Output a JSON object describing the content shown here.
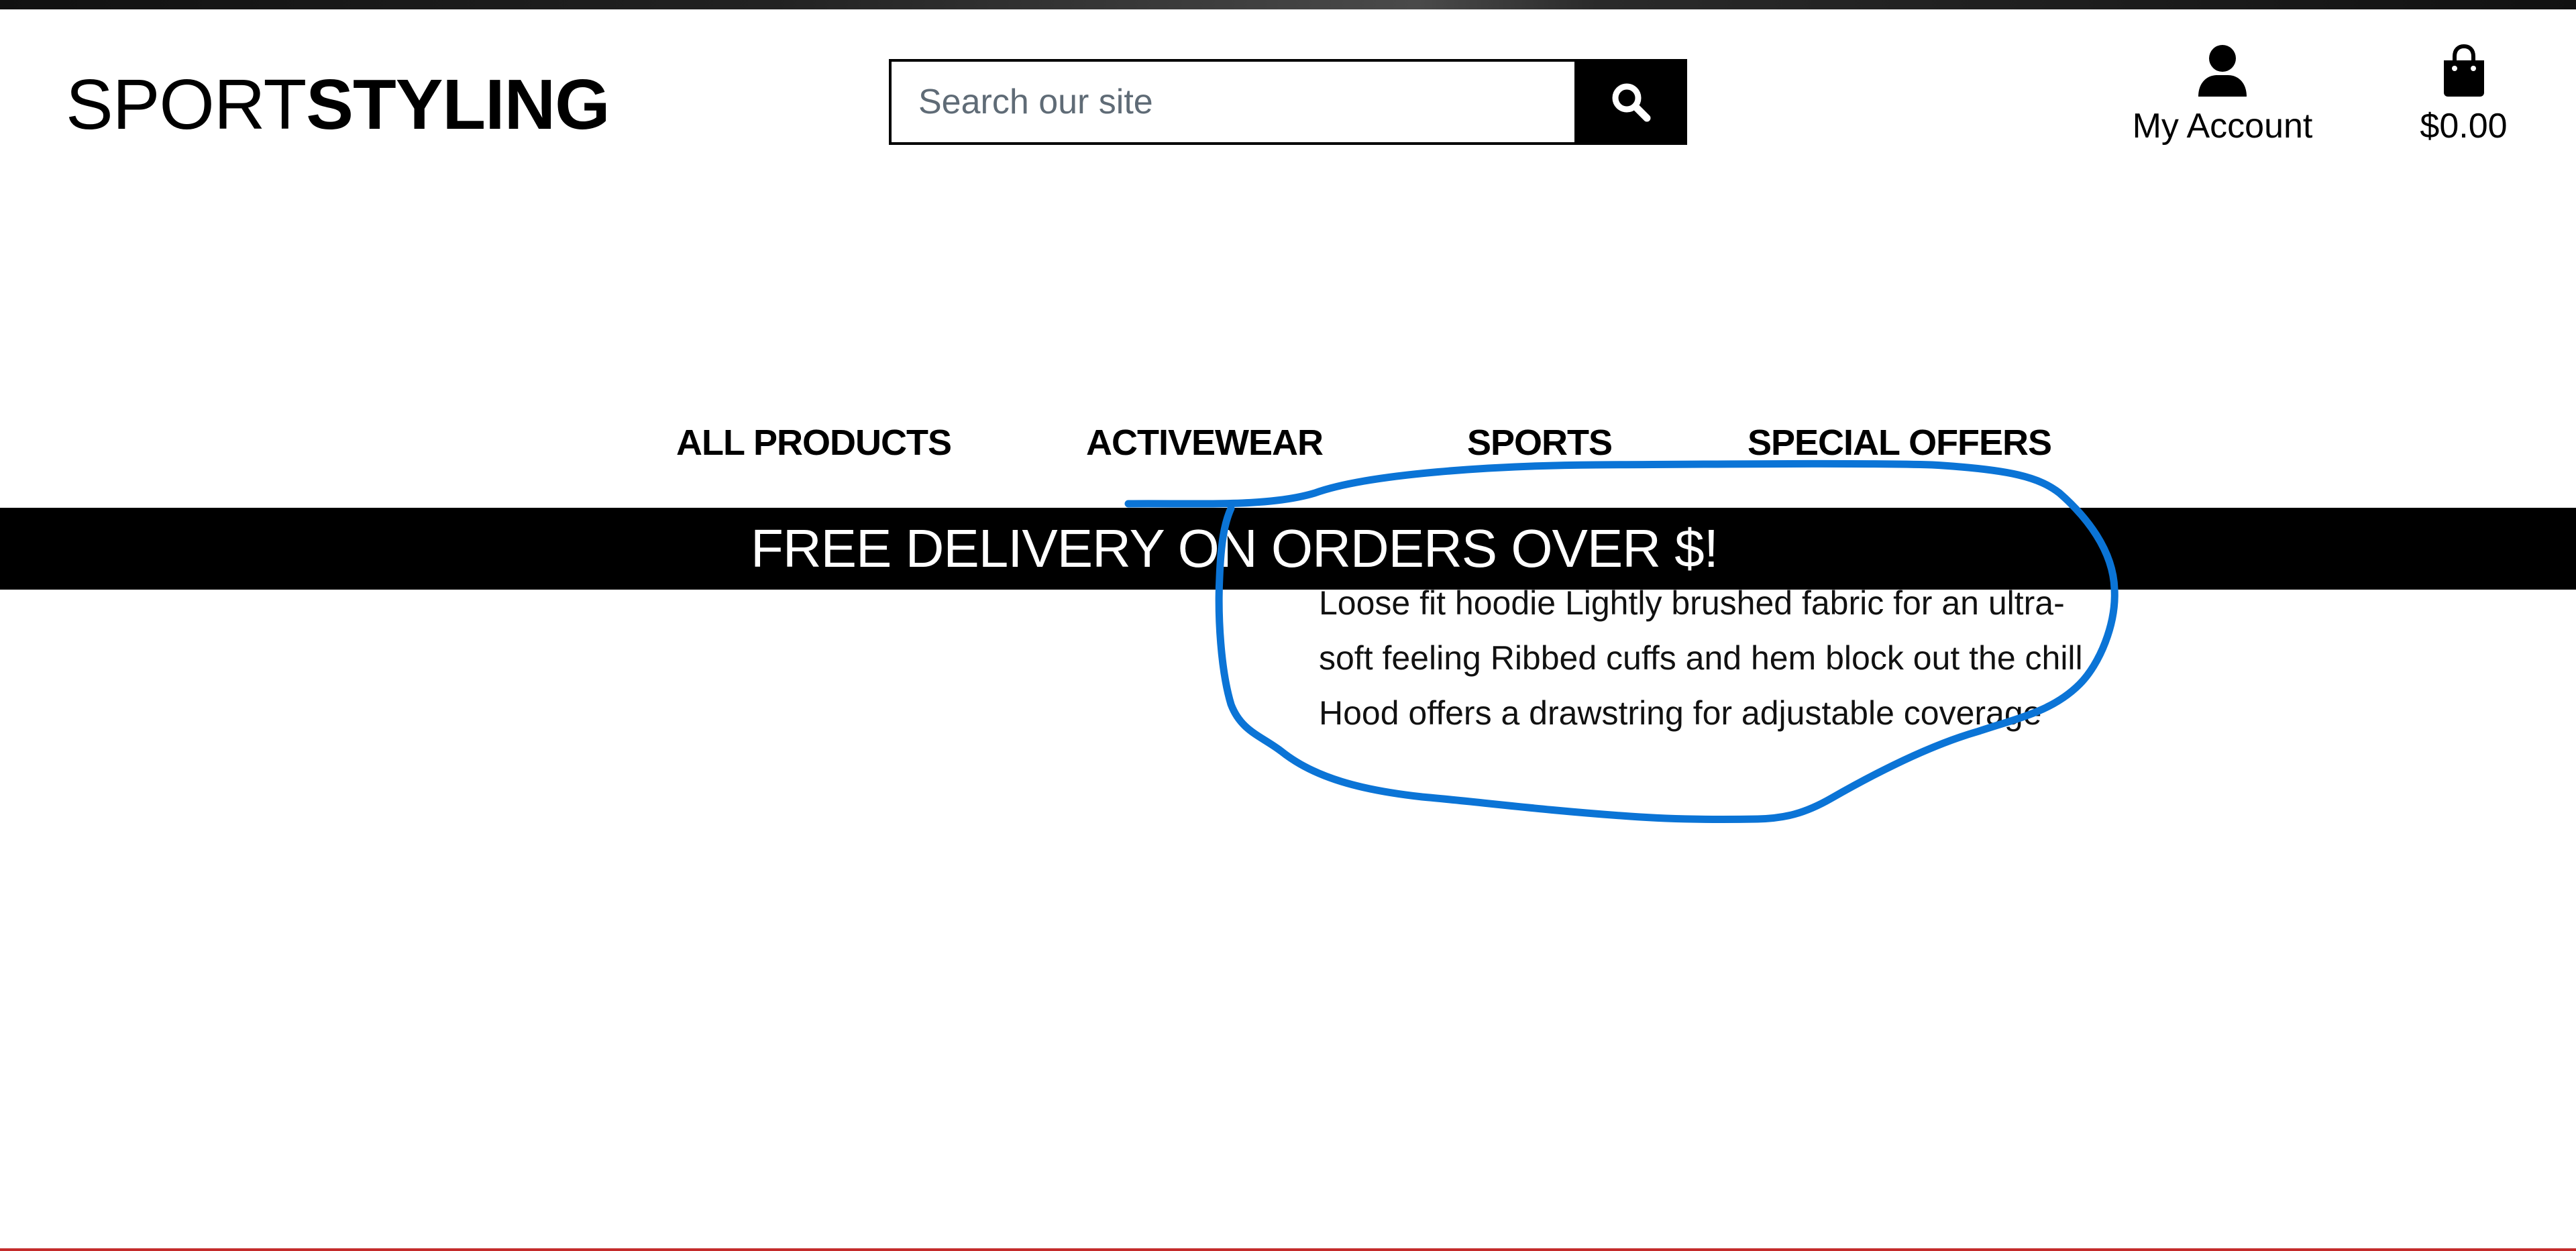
{
  "header": {
    "logo": {
      "light": "SPORT",
      "bold": "STYLING"
    },
    "search": {
      "placeholder": "Search our site",
      "button_icon": "search-icon"
    },
    "account": {
      "label": "My Account",
      "icon": "user-icon"
    },
    "bag": {
      "total": "$0.00",
      "icon": "shopping-bag-icon"
    }
  },
  "nav": {
    "items": [
      {
        "label": "ALL PRODUCTS"
      },
      {
        "label": "ACTIVEWEAR"
      },
      {
        "label": "SPORTS"
      },
      {
        "label": "SPECIAL OFFERS"
      }
    ]
  },
  "banner": {
    "text": "FREE DELIVERY ON ORDERS OVER $!"
  },
  "product": {
    "description": "Loose fit hoodie Lightly brushed fabric for an ultra-soft feeling Ribbed cuffs and hem block out the chill Hood offers a drawstring for adjustable coverage"
  },
  "colors": {
    "annotation": "#0b74d6",
    "banner_bg": "#000000",
    "banner_text": "#ffffff"
  }
}
